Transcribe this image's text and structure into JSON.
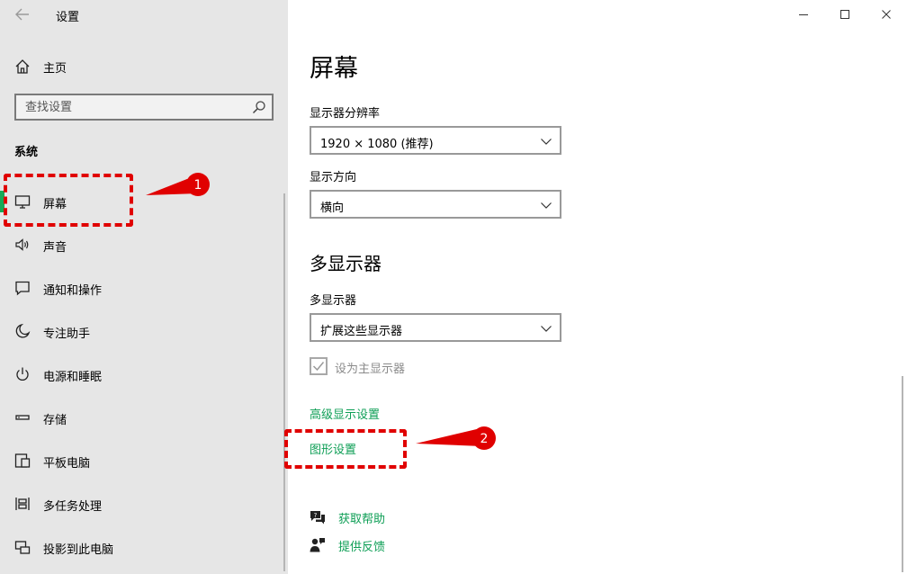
{
  "window": {
    "title": "设置",
    "controls": [
      "minimize",
      "maximize",
      "close"
    ]
  },
  "sidebar": {
    "home_label": "主页",
    "search_placeholder": "查找设置",
    "section_title": "系统",
    "items": [
      {
        "label": "屏幕",
        "icon": "monitor-icon",
        "active": true
      },
      {
        "label": "声音",
        "icon": "speaker-icon"
      },
      {
        "label": "通知和操作",
        "icon": "notification-icon"
      },
      {
        "label": "专注助手",
        "icon": "moon-icon"
      },
      {
        "label": "电源和睡眠",
        "icon": "power-icon"
      },
      {
        "label": "存储",
        "icon": "storage-icon"
      },
      {
        "label": "平板电脑",
        "icon": "tablet-icon"
      },
      {
        "label": "多任务处理",
        "icon": "multitask-icon"
      },
      {
        "label": "投影到此电脑",
        "icon": "project-icon"
      }
    ]
  },
  "main": {
    "title": "屏幕",
    "resolution_label": "显示器分辨率",
    "resolution_value": "1920 × 1080 (推荐)",
    "orientation_label": "显示方向",
    "orientation_value": "横向",
    "multi_display_heading": "多显示器",
    "multi_display_label": "多显示器",
    "multi_display_value": "扩展这些显示器",
    "main_display_checkbox": "设为主显示器",
    "main_display_checked": true,
    "advanced_link": "高级显示设置",
    "graphics_link": "图形设置",
    "help_link": "获取帮助",
    "feedback_link": "提供反馈"
  },
  "annotations": [
    {
      "number": "1",
      "target": "屏幕"
    },
    {
      "number": "2",
      "target": "图形设置"
    }
  ],
  "colors": {
    "accent": "#0d9e55",
    "active_indicator": "#18a957",
    "annotation": "#e00000",
    "sidebar_bg": "#e6e6e6"
  }
}
